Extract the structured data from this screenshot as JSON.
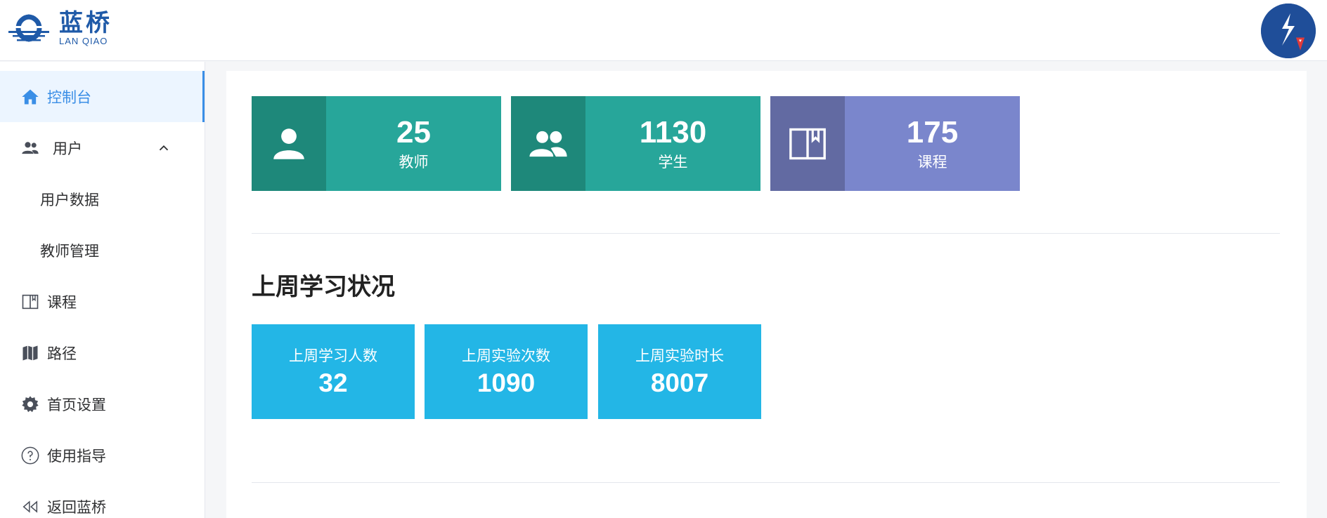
{
  "header": {
    "logo_cn": "蓝桥",
    "logo_en": "LAN QIAO"
  },
  "sidebar": {
    "items": [
      {
        "label": "控制台",
        "icon": "home-icon",
        "active": true
      },
      {
        "label": "用户",
        "icon": "users-icon",
        "expanded": true
      },
      {
        "label": "用户数据",
        "sub": true
      },
      {
        "label": "教师管理",
        "sub": true
      },
      {
        "label": "课程",
        "icon": "book-icon"
      },
      {
        "label": "路径",
        "icon": "map-icon"
      },
      {
        "label": "首页设置",
        "icon": "gear-icon"
      },
      {
        "label": "使用指导",
        "icon": "help-circle-icon"
      },
      {
        "label": "返回蓝桥",
        "icon": "back-arrows-icon"
      }
    ]
  },
  "stats": [
    {
      "value": "25",
      "label": "教师",
      "icon": "user-icon",
      "icon_bg": "#1e887a",
      "body_bg": "#27a69a"
    },
    {
      "value": "1130",
      "label": "学生",
      "icon": "users-icon",
      "icon_bg": "#1e887a",
      "body_bg": "#27a69a"
    },
    {
      "value": "175",
      "label": "课程",
      "icon": "book-icon",
      "icon_bg": "#626aa2",
      "body_bg": "#7a86cc"
    }
  ],
  "last_week": {
    "title": "上周学习状况",
    "cards": [
      {
        "label": "上周学习人数",
        "value": "32"
      },
      {
        "label": "上周实验次数",
        "value": "1090"
      },
      {
        "label": "上周实验时长",
        "value": "8007"
      }
    ]
  },
  "colors": {
    "accent": "#3a8ee6",
    "week_card": "#23b6e6"
  }
}
